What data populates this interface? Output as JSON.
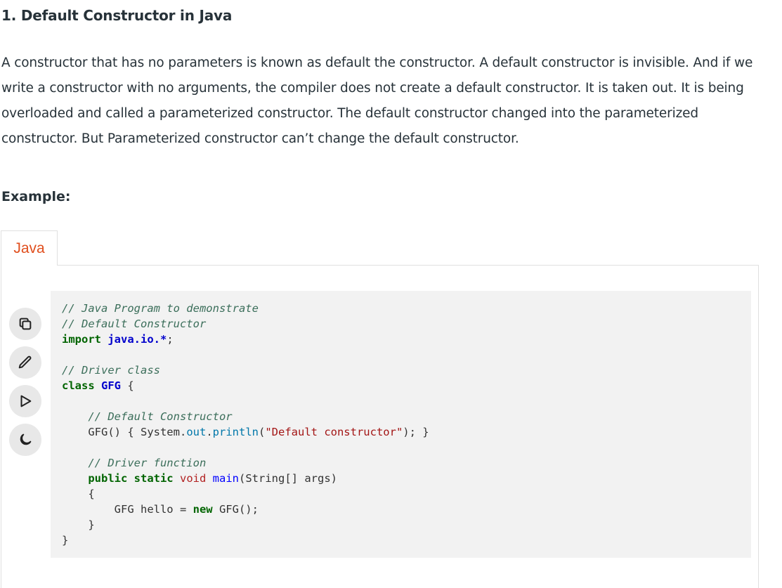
{
  "article": {
    "heading": "1. Default Constructor in Java",
    "paragraph": "A constructor that has no parameters is known as default the constructor. A default constructor is invisible. And if we write a constructor with no arguments, the compiler does not create a default constructor. It is taken out. It is being overloaded and called a parameterized constructor. The default constructor changed into the parameterized constructor. But Parameterized constructor can’t change the default constructor.",
    "example_label": "Example:"
  },
  "code_block": {
    "tab_label": "Java",
    "accent_color": "#e04e1d",
    "side_buttons": [
      "copy-icon",
      "edit-icon",
      "run-icon",
      "dark-mode-icon"
    ],
    "lines": {
      "l1": "// Java Program to demonstrate",
      "l2": "// Default Constructor",
      "l3_kw": "import",
      "l3_pkg": "java.io.*",
      "l3_end": ";",
      "l5": "// Driver class",
      "l6_kw": "class",
      "l6_name": "GFG",
      "l6_end": " {",
      "l8": "// Default Constructor",
      "l9_a": "GFG() { System.",
      "l9_out": "out",
      "l9_dot": ".",
      "l9_fn": "println",
      "l9_p1": "(",
      "l9_str": "\"Default constructor\"",
      "l9_end": "); }",
      "l11": "// Driver function",
      "l12_kw": "public static",
      "l12_ty": "void",
      "l12_fn": "main",
      "l12_args": "(String[] args)",
      "l13": "{",
      "l14_a": "GFG hello = ",
      "l14_kw": "new",
      "l14_b": " GFG();",
      "l15": "}",
      "l16": "}"
    }
  }
}
